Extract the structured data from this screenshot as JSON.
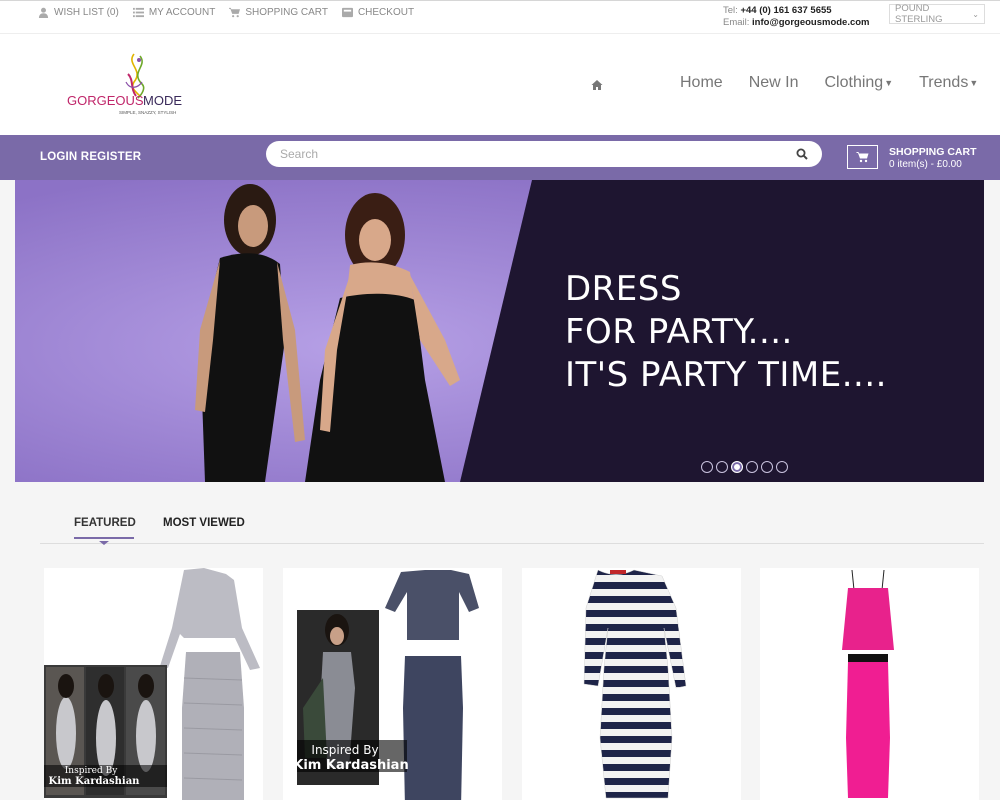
{
  "topbar": {
    "links": [
      {
        "label": "WISH LIST (0)",
        "icon": "user-icon"
      },
      {
        "label": "MY ACCOUNT",
        "icon": "list-icon"
      },
      {
        "label": "SHOPPING CART",
        "icon": "cart-icon"
      },
      {
        "label": "CHECKOUT",
        "icon": "checkout-icon"
      }
    ],
    "tel_label": "Tel:",
    "tel": "+44 (0) 161 637 5655",
    "email_label": "Email:",
    "email": "info@gorgeousmode.com",
    "currency": "POUND STERLING"
  },
  "header": {
    "logo_name_a": "GORGEOUS",
    "logo_name_b": "MODE",
    "logo_tagline": "SIMPLE, SNAZZY, STYLISH",
    "nav": [
      "Home",
      "New In",
      "Clothing",
      "Trends"
    ]
  },
  "bar": {
    "login": "LOGIN REGISTER",
    "search_placeholder": "Search",
    "cart_title": "SHOPPING CART",
    "cart_info": "0 item(s) - £0.00"
  },
  "banner": {
    "line1": "DRESS",
    "line2": "FOR PARTY....",
    "line3": "IT'S PARTY TIME....",
    "slides": 6,
    "active_slide": 3
  },
  "tabs": [
    "FEATURED",
    "MOST VIEWED"
  ],
  "products": [
    {
      "caption_a": "Inspired By",
      "caption_b": "Kim Kardashian"
    },
    {
      "caption_a": "Inspired By",
      "caption_b": "Kim Kardashian"
    },
    {},
    {}
  ],
  "colors": {
    "accent": "#7a6aa8",
    "banner_light": "#9d85d2",
    "banner_dark": "#1e1530",
    "pink": "#ec1f8f"
  }
}
